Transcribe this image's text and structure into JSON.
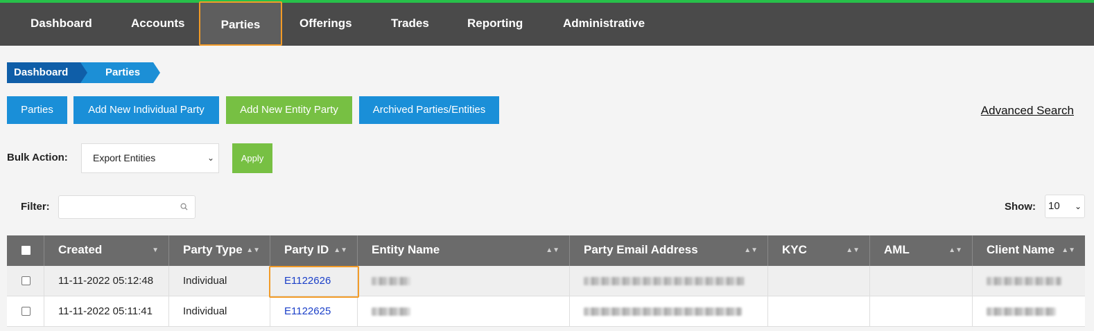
{
  "nav": {
    "items": [
      {
        "label": "Dashboard"
      },
      {
        "label": "Accounts"
      },
      {
        "label": "Parties"
      },
      {
        "label": "Offerings"
      },
      {
        "label": "Trades"
      },
      {
        "label": "Reporting"
      },
      {
        "label": "Administrative"
      }
    ],
    "active": "Parties"
  },
  "breadcrumb": [
    "Dashboard",
    "Parties"
  ],
  "actions": {
    "parties": "Parties",
    "add_individual": "Add New Individual Party",
    "add_entity": "Add New Entity Party",
    "archived": "Archived Parties/Entities",
    "advanced_search": "Advanced Search"
  },
  "bulk": {
    "label": "Bulk Action:",
    "selected": "Export Entities",
    "apply": "Apply"
  },
  "filter": {
    "label": "Filter:",
    "value": ""
  },
  "show": {
    "label": "Show:",
    "value": "10"
  },
  "table": {
    "columns": [
      "Created",
      "Party Type",
      "Party ID",
      "Entity Name",
      "Party Email Address",
      "KYC",
      "AML",
      "Client Name"
    ],
    "rows": [
      {
        "created": "11-11-2022 05:12:48",
        "party_type": "Individual",
        "party_id": "E1122626",
        "kyc": "",
        "aml": ""
      },
      {
        "created": "11-11-2022 05:11:41",
        "party_type": "Individual",
        "party_id": "E1122625",
        "kyc": "",
        "aml": ""
      }
    ]
  },
  "colors": {
    "nav_bg": "#4a4a4a",
    "nav_accent": "#27c04a",
    "highlight": "#f29b27",
    "button_blue": "#1a8fd8",
    "button_green": "#77c043",
    "link": "#1a3fc8"
  }
}
